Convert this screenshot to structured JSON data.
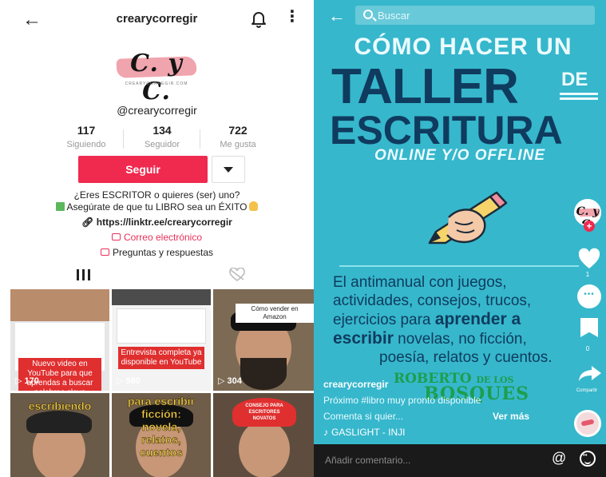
{
  "profile": {
    "header": {
      "username": "crearycorregir"
    },
    "logo": {
      "text": "C. y C.",
      "subtitle": "CREARYCORREGIR.COM"
    },
    "handle": "@crearycorregir",
    "stats": [
      {
        "value": "117",
        "label": "Siguiendo"
      },
      {
        "value": "134",
        "label": "Seguidor"
      },
      {
        "value": "722",
        "label": "Me gusta"
      }
    ],
    "follow_label": "Seguir",
    "bio_line1": "¿Eres ESCRITOR o quieres (ser) uno?",
    "bio_line2": "Asegúrate de que tu LIBRO sea un ÉXITO",
    "link": "https://linktr.ee/crearycorregir",
    "email_label": "Correo electrónico",
    "qa_label": "Preguntas y respuestas",
    "videos": [
      {
        "views": "170",
        "caption": "Nuevo video en YouTube para que aprendas a buscar palabras clave"
      },
      {
        "views": "580",
        "caption": "Entrevista completa ya disponible en YouTube"
      },
      {
        "views": "304",
        "caption": "Cómo vender en Amazon"
      },
      {
        "views": "",
        "caption": "escribiendo"
      },
      {
        "views": "",
        "caption": "para escribir ficción: novela, relatos, cuentos"
      },
      {
        "views": "",
        "caption": "CONSEJO PARA ESCRITORES NOVATOS"
      }
    ]
  },
  "video": {
    "search_placeholder": "Buscar",
    "title_line1": "CÓMO HACER UN",
    "title_line2": "TALLER",
    "title_de": "DE",
    "title_line3": "ESCRITURA",
    "title_line4": "ONLINE Y/O OFFLINE",
    "desc": {
      "l1": "El antimanual con juegos,",
      "l2": "actividades, consejos, trucos,",
      "l3a": "ejercicios para ",
      "l3b": "aprender a",
      "l4a": "escribir",
      "l4b": " novelas, no ficción,",
      "l5": "poesía, relatos y cuentos."
    },
    "side_counts": {
      "likes": "1",
      "bookmarks": "0"
    },
    "share_label": "Compartir",
    "author": "crearycorregir",
    "overlay_line1": "ROBERTO",
    "overlay_line1_small": "DE LOS",
    "overlay_line2": "BOSQUES",
    "caption_line1": "Próximo #libro muy pronto disponible",
    "caption_line2": "Comenta si quier...",
    "see_more": "Ver más",
    "sound": "GASLIGHT - INJI",
    "comment_placeholder": "Añadir comentario..."
  },
  "colors": {
    "accent": "#f0294f",
    "video_bg": "#36b7cc",
    "title_dark": "#0f3b5e"
  }
}
